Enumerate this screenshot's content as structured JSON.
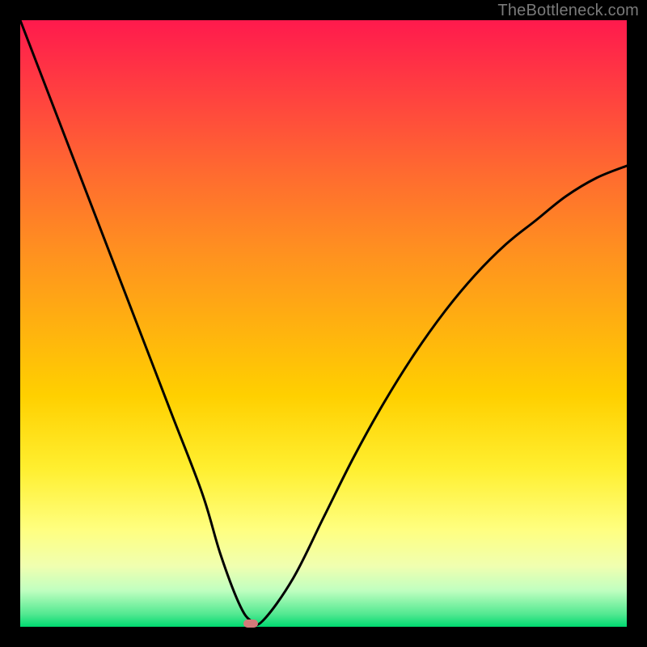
{
  "watermark": "TheBottleneck.com",
  "chart_data": {
    "type": "line",
    "title": "",
    "xlabel": "",
    "ylabel": "",
    "xlim": [
      0,
      100
    ],
    "ylim": [
      0,
      100
    ],
    "grid": false,
    "legend": false,
    "series": [
      {
        "name": "bottleneck-curve",
        "x": [
          0,
          5,
          10,
          15,
          20,
          25,
          30,
          33,
          36,
          38,
          40,
          45,
          50,
          55,
          60,
          65,
          70,
          75,
          80,
          85,
          90,
          95,
          100
        ],
        "values": [
          100,
          87,
          74,
          61,
          48,
          35,
          22,
          12,
          4,
          1,
          1,
          8,
          18,
          28,
          37,
          45,
          52,
          58,
          63,
          67,
          71,
          74,
          76
        ]
      }
    ],
    "marker": {
      "x": 38,
      "y": 0.5,
      "color": "#d47a7a"
    },
    "background_gradient": {
      "type": "vertical",
      "stops": [
        {
          "pos": 0,
          "color": "#ff1a4d"
        },
        {
          "pos": 50,
          "color": "#ffb010"
        },
        {
          "pos": 84,
          "color": "#ffff80"
        },
        {
          "pos": 100,
          "color": "#00d870"
        }
      ]
    }
  }
}
